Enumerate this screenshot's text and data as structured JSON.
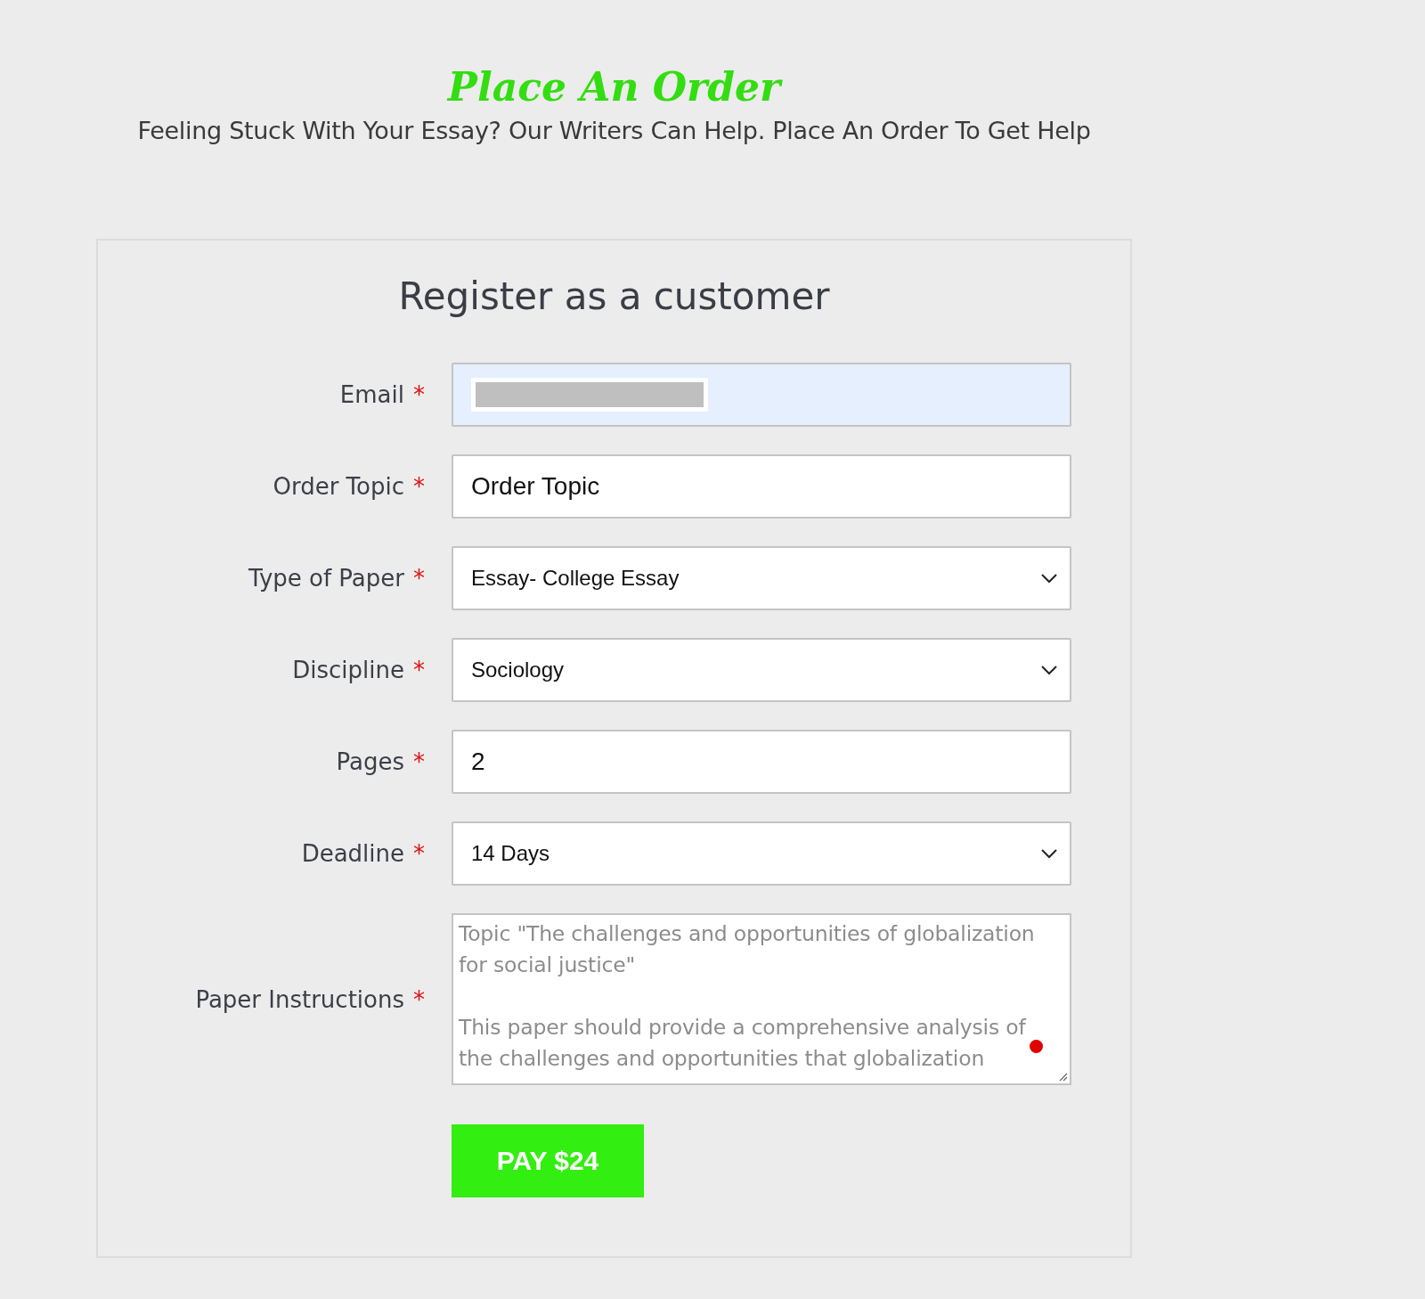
{
  "header": {
    "title": "Place An Order",
    "subtitle": "Feeling Stuck With Your Essay? Our Writers Can Help. Place An Order To Get Help"
  },
  "form": {
    "title": "Register as a customer",
    "fields": [
      {
        "label": "Email",
        "required": "*",
        "kind": "text",
        "redacted": true
      },
      {
        "label": "Order Topic",
        "required": "*",
        "kind": "text",
        "value": "Order Topic"
      },
      {
        "label": "Type of Paper",
        "required": "*",
        "kind": "select",
        "value": "Essay- College Essay"
      },
      {
        "label": "Discipline",
        "required": "*",
        "kind": "select",
        "value": "Sociology"
      },
      {
        "label": "Pages",
        "required": "*",
        "kind": "text",
        "value": "2"
      },
      {
        "label": "Deadline",
        "required": "*",
        "kind": "select",
        "value": "14 Days"
      },
      {
        "label": "Paper Instructions",
        "required": "*",
        "kind": "textarea",
        "value": "Topic \"The challenges and opportunities of globalization for social justice\"\n\nThis paper should provide a comprehensive analysis of the challenges and opportunities that globalization"
      }
    ],
    "submit": "PAY $24"
  }
}
